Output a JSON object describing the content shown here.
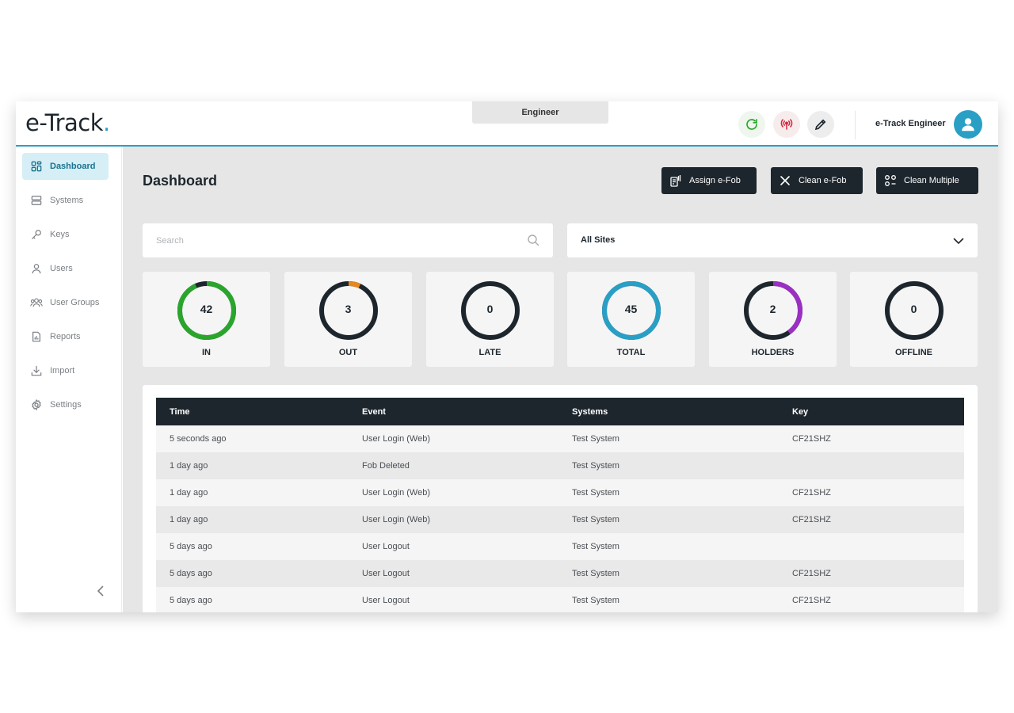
{
  "app": {
    "logo_text": "e-Track",
    "logo_dot": ".",
    "role": "Engineer",
    "user_name": "e-Track Engineer",
    "accent": "#2a9fc6"
  },
  "topbar_icons": [
    "refresh-icon",
    "signal-icon",
    "pen-icon",
    "user-avatar-icon"
  ],
  "sidebar": {
    "items": [
      {
        "label": "Dashboard",
        "icon": "dashboard-icon",
        "active": true
      },
      {
        "label": "Systems",
        "icon": "systems-icon"
      },
      {
        "label": "Keys",
        "icon": "key-icon"
      },
      {
        "label": "Users",
        "icon": "user-icon"
      },
      {
        "label": "User Groups",
        "icon": "user-groups-icon"
      },
      {
        "label": "Reports",
        "icon": "reports-icon"
      },
      {
        "label": "Import",
        "icon": "import-icon"
      },
      {
        "label": "Settings",
        "icon": "settings-icon"
      }
    ]
  },
  "main": {
    "title": "Dashboard",
    "actions": [
      "Assign e-Fob",
      "Clean e-Fob",
      "Clean Multiple"
    ],
    "search_placeholder": "Search",
    "site_select": "All Sites"
  },
  "stats": [
    {
      "label": "IN",
      "value": "42",
      "fraction": 0.933,
      "color": "#2aa52c"
    },
    {
      "label": "OUT",
      "value": "3",
      "fraction": 0.067,
      "color": "#e8871e"
    },
    {
      "label": "LATE",
      "value": "0",
      "fraction": 0,
      "color": "#1d262d"
    },
    {
      "label": "TOTAL",
      "value": "45",
      "fraction": 1,
      "color": "#2a9fc6"
    },
    {
      "label": "HOLDERS",
      "value": "2",
      "fraction": 0.4,
      "color": "#9b2fc4"
    },
    {
      "label": "OFFLINE",
      "value": "0",
      "fraction": 0,
      "color": "#1d262d"
    }
  ],
  "table": {
    "headers": [
      "Time",
      "Event",
      "Systems",
      "Key"
    ],
    "rows": [
      [
        "5 seconds ago",
        "User Login (Web)",
        "Test System",
        "CF21SHZ"
      ],
      [
        "1 day ago",
        "Fob Deleted",
        "Test System",
        ""
      ],
      [
        "1 day ago",
        "User Login (Web)",
        "Test System",
        "CF21SHZ"
      ],
      [
        "1 day ago",
        "User Login (Web)",
        "Test System",
        "CF21SHZ"
      ],
      [
        "5 days ago",
        "User Logout",
        "Test System",
        ""
      ],
      [
        "5 days ago",
        "User Logout",
        "Test System",
        "CF21SHZ"
      ],
      [
        "5 days ago",
        "User Logout",
        "Test System",
        "CF21SHZ"
      ]
    ]
  }
}
